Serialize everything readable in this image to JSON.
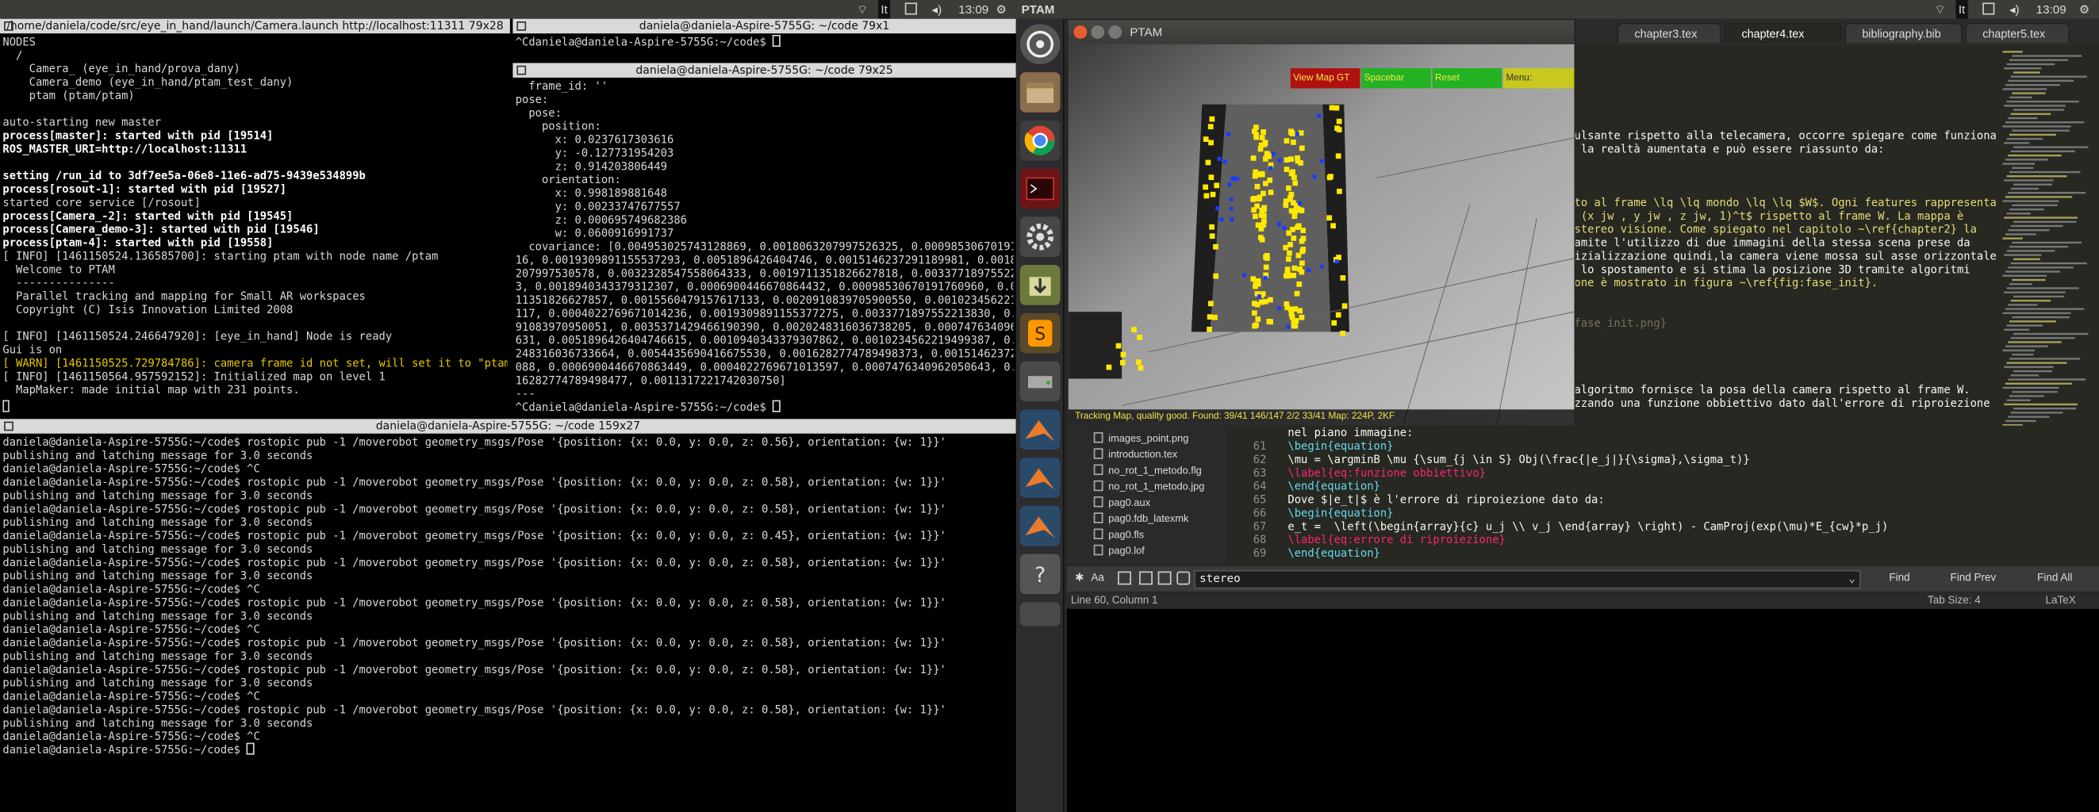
{
  "panel": {
    "left_time": "13:09",
    "left_title": "PTAM",
    "right_time": "13:09"
  },
  "term1": {
    "title": "/home/daniela/code/src/eye_in_hand/launch/Camera.launch http://localhost:11311 79x28",
    "lines": [
      {
        "t": "NODES",
        "c": ""
      },
      {
        "t": "  /",
        "c": ""
      },
      {
        "t": "    Camera_ (eye_in_hand/prova_dany)",
        "c": ""
      },
      {
        "t": "    Camera_demo (eye_in_hand/ptam_test_dany)",
        "c": ""
      },
      {
        "t": "    ptam (ptam/ptam)",
        "c": ""
      },
      {
        "t": "",
        "c": ""
      },
      {
        "t": "auto-starting new master",
        "c": ""
      },
      {
        "t": "process[master]: started with pid [19514]",
        "c": "hl"
      },
      {
        "t": "ROS_MASTER_URI=http://localhost:11311",
        "c": "hl"
      },
      {
        "t": "",
        "c": ""
      },
      {
        "t": "setting /run_id to 3df7ee5a-06e8-11e6-ad75-9439e534899b",
        "c": "hl"
      },
      {
        "t": "process[rosout-1]: started with pid [19527]",
        "c": "hl"
      },
      {
        "t": "started core service [/rosout]",
        "c": ""
      },
      {
        "t": "process[Camera_-2]: started with pid [19545]",
        "c": "hl"
      },
      {
        "t": "process[Camera_demo-3]: started with pid [19546]",
        "c": "hl"
      },
      {
        "t": "process[ptam-4]: started with pid [19558]",
        "c": "hl"
      },
      {
        "t": "[ INFO] [1461150524.136585700]: starting ptam with node name /ptam",
        "c": ""
      },
      {
        "t": "  Welcome to PTAM",
        "c": ""
      },
      {
        "t": "  ---------------",
        "c": ""
      },
      {
        "t": "  Parallel tracking and mapping for Small AR workspaces",
        "c": ""
      },
      {
        "t": "  Copyright (C) Isis Innovation Limited 2008",
        "c": ""
      },
      {
        "t": "",
        "c": ""
      },
      {
        "t": "[ INFO] [1461150524.246647920]: [eye_in_hand] Node is ready",
        "c": ""
      },
      {
        "t": "Gui is on",
        "c": ""
      },
      {
        "t": "[ WARN] [1461150525.729784786]: camera frame id not set, will set it to \"ptam\"",
        "c": "warn"
      },
      {
        "t": "[ INFO] [1461150564.957592152]: Initialized map on level 1",
        "c": ""
      },
      {
        "t": "  MapMaker: made initial map with 231 points.",
        "c": ""
      }
    ]
  },
  "term2": {
    "title": "daniela@daniela-Aspire-5755G: ~/code 79x1",
    "line": "^Cdaniela@daniela-Aspire-5755G:~/code$ "
  },
  "term3": {
    "title": "daniela@daniela-Aspire-5755G: ~/code 79x25",
    "lines": [
      "  frame_id: ''",
      "pose:",
      "  pose:",
      "    position:",
      "      x: 0.0237617303616",
      "      y: -0.127731954203",
      "      z: 0.914203806449",
      "    orientation:",
      "      x: 0.998189881648",
      "      y: 0.00233747677557",
      "      z: 0.000695749682386",
      "      w: 0.0600916991737",
      "  covariance: [0.004953025743128869, 0.0018063207997526325, 0.000985306701917131",
      "16, 0.0019309891155537293, 0.0051896426404746, 0.0015146237291189981, 0.0018063",
      "207997530578, 0.0032328547558064333, 0.0019711351826627818, 0.00337718975522138",
      "3, 0.0018940343379312307, 0.0006900446670864432, 0.00098530670191760960, 0.00197",
      "11351826627857, 0.0015560479157617133, 0.0020910839705900550, 0.0010234562219497",
      "117, 0.0004022769671014236, 0.0019309891155377275, 0.0033771897552213830, 0.0020",
      "91083970950051, 0.0035371429466190390, 0.0020248316036738205, 0.0007476340962051",
      "631, 0.0051896426404746615, 0.0010940343379307862, 0.0010234562219499387, 0.0020",
      "248316036733664, 0.0054435690416675530, 0.0016282774789498373, 0.0015146237291190",
      "088, 0.0006900446670863449, 0.0004022769671013597, 0.0007476340962050643, 0.00",
      "16282774789498477, 0.0011317221742030750]",
      "---",
      "^Cdaniela@daniela-Aspire-5755G:~/code$ "
    ]
  },
  "term4": {
    "title": "daniela@daniela-Aspire-5755G: ~/code 159x27",
    "lines": [
      "daniela@daniela-Aspire-5755G:~/code$ rostopic pub -1 /moverobot geometry_msgs/Pose '{position: {x: 0.0, y: 0.0, z: 0.56}, orientation: {w: 1}}'",
      "publishing and latching message for 3.0 seconds",
      "daniela@daniela-Aspire-5755G:~/code$ ^C",
      "daniela@daniela-Aspire-5755G:~/code$ rostopic pub -1 /moverobot geometry_msgs/Pose '{position: {x: 0.0, y: 0.0, z: 0.58}, orientation: {w: 1}}'",
      "publishing and latching message for 3.0 seconds",
      "daniela@daniela-Aspire-5755G:~/code$ rostopic pub -1 /moverobot geometry_msgs/Pose '{position: {x: 0.0, y: 0.0, z: 0.58}, orientation: {w: 1}}'",
      "publishing and latching message for 3.0 seconds",
      "daniela@daniela-Aspire-5755G:~/code$ rostopic pub -1 /moverobot geometry_msgs/Pose '{position: {x: 0.0, y: 0.0, z: 0.45}, orientation: {w: 1}}'",
      "publishing and latching message for 3.0 seconds",
      "daniela@daniela-Aspire-5755G:~/code$ rostopic pub -1 /moverobot geometry_msgs/Pose '{position: {x: 0.0, y: 0.0, z: 0.58}, orientation: {w: 1}}'",
      "publishing and latching message for 3.0 seconds",
      "daniela@daniela-Aspire-5755G:~/code$ ^C",
      "daniela@daniela-Aspire-5755G:~/code$ rostopic pub -1 /moverobot geometry_msgs/Pose '{position: {x: 0.0, y: 0.0, z: 0.58}, orientation: {w: 1}}'",
      "publishing and latching message for 3.0 seconds",
      "daniela@daniela-Aspire-5755G:~/code$ ^C",
      "daniela@daniela-Aspire-5755G:~/code$ rostopic pub -1 /moverobot geometry_msgs/Pose '{position: {x: 0.0, y: 0.0, z: 0.58}, orientation: {w: 1}}'",
      "publishing and latching message for 3.0 seconds",
      "daniela@daniela-Aspire-5755G:~/code$ rostopic pub -1 /moverobot geometry_msgs/Pose '{position: {x: 0.0, y: 0.0, z: 0.58}, orientation: {w: 1}}'",
      "publishing and latching message for 3.0 seconds",
      "daniela@daniela-Aspire-5755G:~/code$ ^C",
      "daniela@daniela-Aspire-5755G:~/code$ rostopic pub -1 /moverobot geometry_msgs/Pose '{position: {x: 0.0, y: 0.0, z: 0.58}, orientation: {w: 1}}'",
      "publishing and latching message for 3.0 seconds",
      "daniela@daniela-Aspire-5755G:~/code$ ^C",
      "daniela@daniela-Aspire-5755G:~/code$ "
    ]
  },
  "ptam": {
    "title": "PTAM",
    "menu": [
      "View Map GT",
      "Spacebar",
      "Reset",
      "Menu:"
    ],
    "status": "Tracking Map, quality good. Found: 39/41 146/147 2/2 33/41 Map: 224P, 2KF"
  },
  "editor": {
    "tabs": [
      "chapter3.tex",
      "chapter4.tex",
      "bibliography.bib",
      "chapter5.tex"
    ],
    "active_tab": "chapter4.tex",
    "body_lines": [
      "ulsante rispetto alla telecamera, occorre spiegare come funziona",
      " la realtà aumentata e può essere riassunto da:",
      "",
      "",
      "",
      "to al frame \\lq \\lq mondo \\lq \\lq $W$. Ogni features rappresenta",
      " (x_jw , y_jw , z_jw, 1)^t$ rispetto al frame W. La mappa è",
      "stereo visione. Come spiegato nel capitolo ~\\ref{chapter2} la",
      "amite l'utilizzo di due immagini della stessa scena prese da",
      "izializzazione quindi,la camera viene mossa sul asse orizzontale,",
      " lo spostamento e si stima la posizione 3D tramite algoritmi",
      "one è mostrato in figura ~\\ref{fig:fase_init}.",
      "",
      "",
      "fase_init.png}",
      "",
      "",
      "",
      "",
      "algoritmo fornisce la posa della camera rispetto al frame W.",
      "zzando una funzione obbiettivo dato dall'errore di riproiezione"
    ],
    "code_lines": [
      {
        "n": "",
        "t": "nel piano immagine:"
      },
      {
        "n": "61",
        "t": "\\begin{equation}"
      },
      {
        "n": "62",
        "t": "\\mu = \\argminB \\mu {\\sum_{j \\in S} Obj(\\frac{|e_j|}{\\sigma},\\sigma_t)}"
      },
      {
        "n": "63",
        "t": "\\label{eq:funzione obbiettivo}"
      },
      {
        "n": "64",
        "t": "\\end{equation}"
      },
      {
        "n": "65",
        "t": "Dove $|e_t|$ è l'errore di riproiezione dato da:"
      },
      {
        "n": "66",
        "t": "\\begin{equation}"
      },
      {
        "n": "67",
        "t": "e_t =  \\left(\\begin{array}{c} u_j \\\\ v_j \\end{array} \\right) - CamProj(exp(\\mu)*E_{cw}*p_j)"
      },
      {
        "n": "68",
        "t": "\\label{eq:errore di riproiezione}"
      },
      {
        "n": "69",
        "t": "\\end{equation}"
      }
    ],
    "files": [
      "images_point.png",
      "introduction.tex",
      "no_rot_1_metodo.flg",
      "no_rot_1_metodo.jpg",
      "pag0.aux",
      "pag0.fdb_latexmk",
      "pag0.fls",
      "pag0.lof"
    ],
    "find": {
      "label": "Aa",
      "value": "stereo",
      "find": "Find",
      "find_prev": "Find Prev",
      "find_all": "Find All"
    },
    "status": {
      "pos": "Line 60, Column 1",
      "tab": "Tab Size: 4",
      "syntax": "LaTeX"
    }
  }
}
